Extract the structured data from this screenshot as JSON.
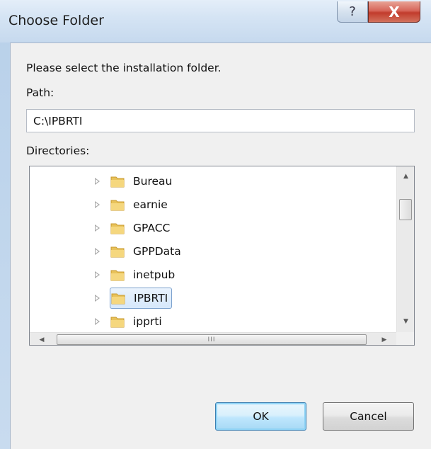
{
  "window": {
    "title": "Choose Folder",
    "help_icon": "?",
    "close_icon": "X"
  },
  "prompt": "Please select the installation folder.",
  "path": {
    "label": "Path:",
    "value": "C:\\IPBRTI"
  },
  "directories": {
    "label": "Directories:",
    "items": [
      {
        "label": "Bureau",
        "selected": false
      },
      {
        "label": "earnie",
        "selected": false
      },
      {
        "label": "GPACC",
        "selected": false
      },
      {
        "label": "GPPData",
        "selected": false
      },
      {
        "label": "inetpub",
        "selected": false
      },
      {
        "label": "IPBRTI",
        "selected": true
      },
      {
        "label": "ipprti",
        "selected": false
      }
    ],
    "hscroll_grip": "III"
  },
  "buttons": {
    "ok": "OK",
    "cancel": "Cancel"
  },
  "colors": {
    "folder": "#e8c25a",
    "selection_border": "#7da2ce",
    "close_button": "#c23b2c"
  }
}
